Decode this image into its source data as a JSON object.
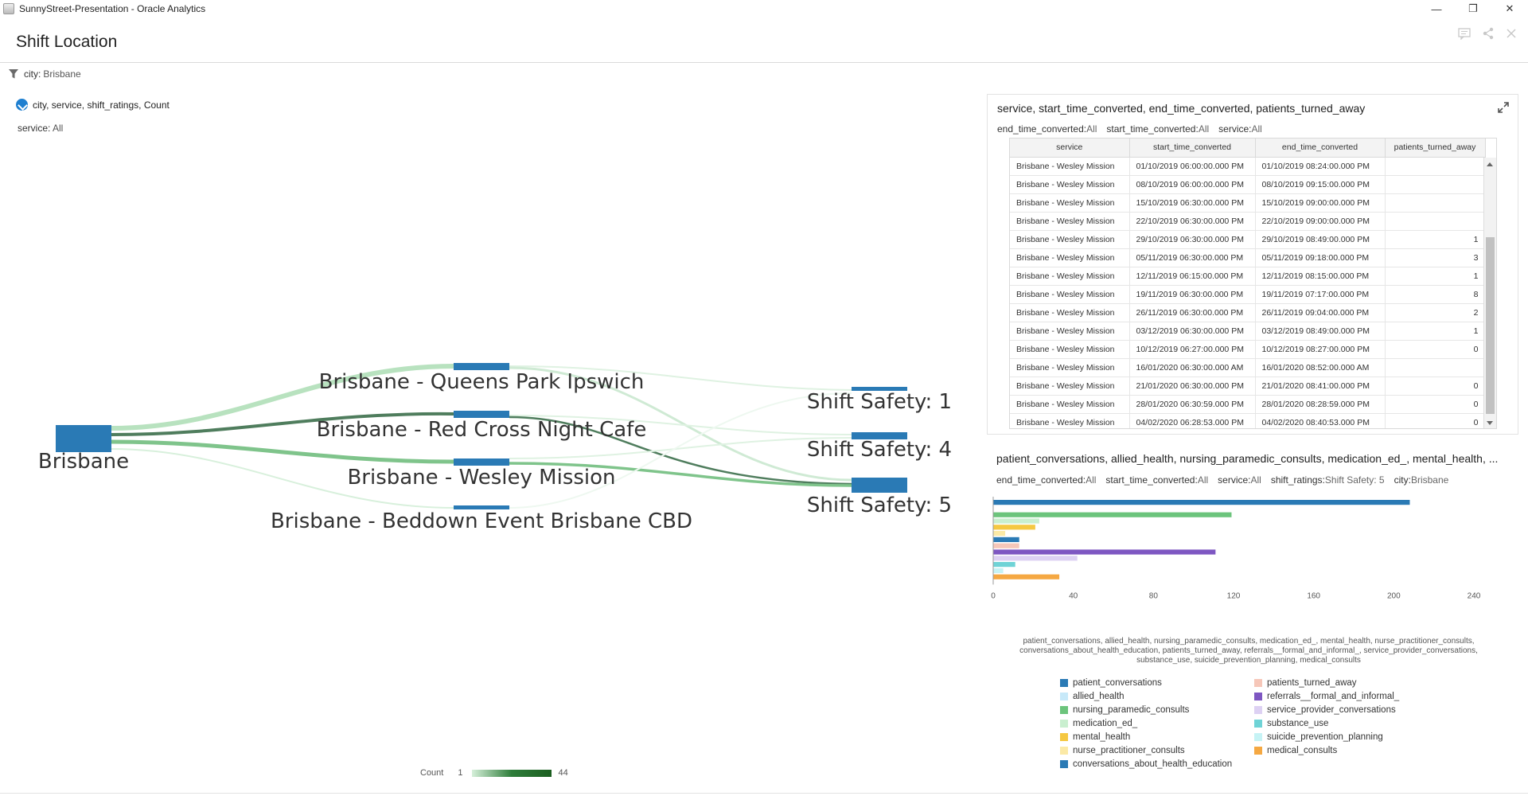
{
  "window": {
    "title": "SunnyStreet-Presentation - Oracle Analytics",
    "minimize": "—",
    "restore": "❐",
    "close": "✕"
  },
  "page": {
    "title": "Shift Location"
  },
  "filter": {
    "key": "city:",
    "value": "Brisbane"
  },
  "sankey": {
    "title": "city, service, shift_ratings, Count",
    "filter_key": "service:",
    "filter_value": "All",
    "nodes_left": [
      "Brisbane"
    ],
    "nodes_mid": [
      "Brisbane - Queens Park Ipswich",
      "Brisbane - Red Cross Night Cafe",
      "Brisbane - Wesley Mission",
      "Brisbane - Beddown Event Brisbane CBD"
    ],
    "nodes_right": [
      "Shift Safety: 1",
      "Shift Safety: 4",
      "Shift Safety: 5"
    ],
    "legend_label": "Count",
    "legend_min": "1",
    "legend_max": "44",
    "colors": {
      "node": "#2a7ab5",
      "link_light": "#b8e2bf",
      "link_mid": "#7fc48b",
      "link_dark": "#4f7d5d"
    }
  },
  "table_viz": {
    "title": "service, start_time_converted, end_time_converted, patients_turned_away",
    "filters": [
      {
        "key": "end_time_converted:",
        "value": "All"
      },
      {
        "key": "start_time_converted:",
        "value": "All"
      },
      {
        "key": "service:",
        "value": "All"
      }
    ],
    "columns": [
      "service",
      "start_time_converted",
      "end_time_converted",
      "patients_turned_away"
    ],
    "rows": [
      [
        "Brisbane - Wesley Mission",
        "01/10/2019 06:00:00.000 PM",
        "01/10/2019 08:24:00.000 PM",
        ""
      ],
      [
        "Brisbane - Wesley Mission",
        "08/10/2019 06:00:00.000 PM",
        "08/10/2019 09:15:00.000 PM",
        ""
      ],
      [
        "Brisbane - Wesley Mission",
        "15/10/2019 06:30:00.000 PM",
        "15/10/2019 09:00:00.000 PM",
        ""
      ],
      [
        "Brisbane - Wesley Mission",
        "22/10/2019 06:30:00.000 PM",
        "22/10/2019 09:00:00.000 PM",
        ""
      ],
      [
        "Brisbane - Wesley Mission",
        "29/10/2019 06:30:00.000 PM",
        "29/10/2019 08:49:00.000 PM",
        "1"
      ],
      [
        "Brisbane - Wesley Mission",
        "05/11/2019 06:30:00.000 PM",
        "05/11/2019 09:18:00.000 PM",
        "3"
      ],
      [
        "Brisbane - Wesley Mission",
        "12/11/2019 06:15:00.000 PM",
        "12/11/2019 08:15:00.000 PM",
        "1"
      ],
      [
        "Brisbane - Wesley Mission",
        "19/11/2019 06:30:00.000 PM",
        "19/11/2019 07:17:00.000 PM",
        "8"
      ],
      [
        "Brisbane - Wesley Mission",
        "26/11/2019 06:30:00.000 PM",
        "26/11/2019 09:04:00.000 PM",
        "2"
      ],
      [
        "Brisbane - Wesley Mission",
        "03/12/2019 06:30:00.000 PM",
        "03/12/2019 08:49:00.000 PM",
        "1"
      ],
      [
        "Brisbane - Wesley Mission",
        "10/12/2019 06:27:00.000 PM",
        "10/12/2019 08:27:00.000 PM",
        "0"
      ],
      [
        "Brisbane - Wesley Mission",
        "16/01/2020 06:30:00.000 AM",
        "16/01/2020 08:52:00.000 AM",
        ""
      ],
      [
        "Brisbane - Wesley Mission",
        "21/01/2020 06:30:00.000 PM",
        "21/01/2020 08:41:00.000 PM",
        "0"
      ],
      [
        "Brisbane - Wesley Mission",
        "28/01/2020 06:30:59.000 PM",
        "28/01/2020 08:28:59.000 PM",
        "0"
      ],
      [
        "Brisbane - Wesley Mission",
        "04/02/2020 06:28:53.000 PM",
        "04/02/2020 08:40:53.000 PM",
        "0"
      ]
    ]
  },
  "bar_viz": {
    "title": "patient_conversations, allied_health, nursing_paramedic_consults, medication_ed_, mental_health, ...",
    "filters": [
      {
        "key": "end_time_converted:",
        "value": "All"
      },
      {
        "key": "start_time_converted:",
        "value": "All"
      },
      {
        "key": "service:",
        "value": "All"
      },
      {
        "key": "shift_ratings:",
        "value": "Shift Safety: 5"
      },
      {
        "key": "city:",
        "value": "Brisbane"
      }
    ],
    "axis_title_line1": "patient_conversations, allied_health, nursing_paramedic_consults, medication_ed_, mental_health, nurse_practitioner_consults,",
    "axis_title_line2": "conversations_about_health_education, patients_turned_away, referrals__formal_and_informal_, service_provider_conversations,",
    "axis_title_line3": "substance_use, suicide_prevention_planning, medical_consults"
  },
  "chart_data": {
    "type": "bar",
    "orientation": "horizontal",
    "x_ticks": [
      "0",
      "40",
      "80",
      "120",
      "160",
      "200",
      "240"
    ],
    "xlim": [
      0,
      240
    ],
    "legend_placement": "bottom",
    "series": [
      {
        "name": "patient_conversations",
        "value": 208,
        "color": "#2a7ab5"
      },
      {
        "name": "allied_health",
        "value": 0,
        "color": "#c7e9f9"
      },
      {
        "name": "nursing_paramedic_consults",
        "value": 119,
        "color": "#6cc47c"
      },
      {
        "name": "medication_ed_",
        "value": 23,
        "color": "#c9efcf"
      },
      {
        "name": "mental_health",
        "value": 21,
        "color": "#f5c842"
      },
      {
        "name": "nurse_practitioner_consults",
        "value": 6,
        "color": "#fbe9a6"
      },
      {
        "name": "conversations_about_health_education",
        "value": 13,
        "color": "#2a7ab5"
      },
      {
        "name": "patients_turned_away",
        "value": 13,
        "color": "#f6c7b9"
      },
      {
        "name": "referrals__formal_and_informal_",
        "value": 111,
        "color": "#7e57c2"
      },
      {
        "name": "service_provider_conversations",
        "value": 42,
        "color": "#ddd1f3"
      },
      {
        "name": "substance_use",
        "value": 11,
        "color": "#6fd3d6"
      },
      {
        "name": "suicide_prevention_planning",
        "value": 5,
        "color": "#c6f3f5"
      },
      {
        "name": "medical_consults",
        "value": 33,
        "color": "#f5a842"
      }
    ],
    "legend_left": [
      "patient_conversations",
      "allied_health",
      "nursing_paramedic_consults",
      "medication_ed_",
      "mental_health",
      "nurse_practitioner_consults",
      "conversations_about_health_education"
    ],
    "legend_right": [
      "patients_turned_away",
      "referrals__formal_and_informal_",
      "service_provider_conversations",
      "substance_use",
      "suicide_prevention_planning",
      "medical_consults"
    ]
  }
}
